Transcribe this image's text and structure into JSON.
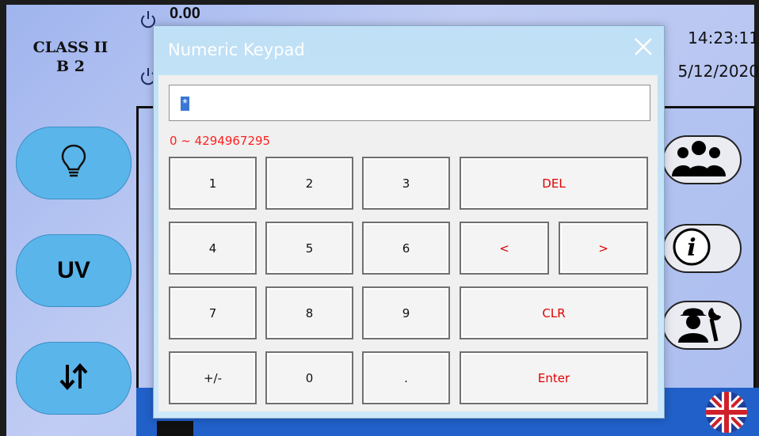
{
  "status": {
    "class_line1": "CLASS II",
    "class_line2": "B 2",
    "top_value": "0.00",
    "time": "14:23:11",
    "date": "5/12/2020"
  },
  "sidebar": {
    "uv_label": "UV"
  },
  "dialog": {
    "title": "Numeric Keypad",
    "input_value": "*",
    "range_text": "0 ~ 4294967295",
    "keys": {
      "k1": "1",
      "k2": "2",
      "k3": "3",
      "del": "DEL",
      "k4": "4",
      "k5": "5",
      "k6": "6",
      "left": "<",
      "right": ">",
      "k7": "7",
      "k8": "8",
      "k9": "9",
      "clr": "CLR",
      "sign": "+/-",
      "k0": "0",
      "dot": ".",
      "enter": "Enter"
    }
  },
  "colors": {
    "accent_red": "#e00000",
    "side_button_blue": "#5ab5ea",
    "bottom_bar_blue": "#2060c8"
  },
  "icons": [
    "lightbulb-icon",
    "sort-arrows-icon",
    "users-icon",
    "info-icon",
    "service-worker-icon",
    "uk-flag-icon",
    "close-icon",
    "power-icon"
  ]
}
